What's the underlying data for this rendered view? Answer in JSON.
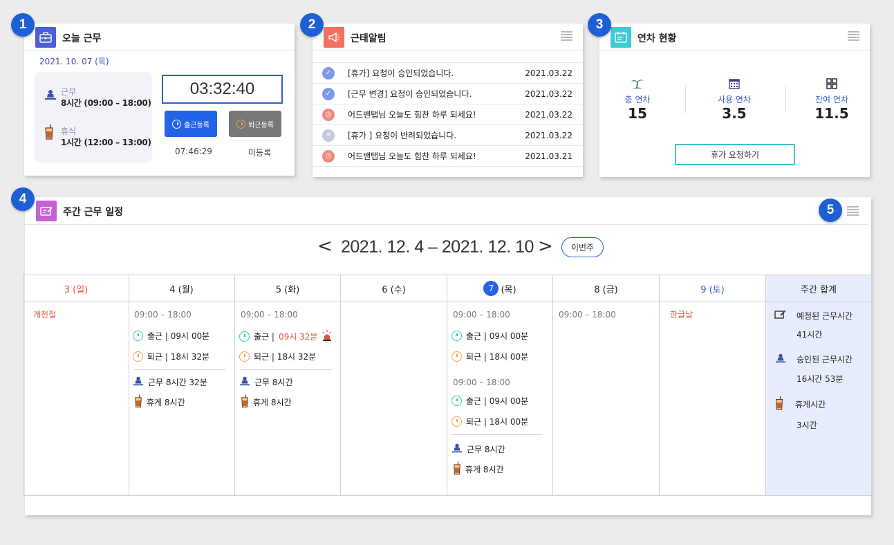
{
  "badges": [
    "1",
    "2",
    "3",
    "4",
    "5"
  ],
  "today_work": {
    "title": "오늘 근무",
    "date": "2021. 10. 07 (목)",
    "work_label": "근무",
    "work_value": "8시간  (09:00 – 18:00)",
    "rest_label": "휴식",
    "rest_value": "1시간  (12:00 – 13:00)",
    "clock": "03:32:40",
    "checkin_button": "출근등록",
    "checkout_button": "퇴근등록",
    "checkin_time": "07:46:29",
    "checkout_status": "미등록"
  },
  "alerts": {
    "title": "근태알림",
    "items": [
      {
        "text": "[휴가] 요청이 승인되었습니다.",
        "date": "2021.03.22",
        "icon": "check-icon",
        "color": "#7d98e8"
      },
      {
        "text": "[근무 변경] 요청이 승인되었습니다.",
        "date": "2021.03.22",
        "icon": "check-icon",
        "color": "#7d98e8"
      },
      {
        "text": "어드밴탭님 오늘도 힘찬 하루 되세요!",
        "date": "2021.03.22",
        "icon": "clock-icon",
        "color": "#f08a80"
      },
      {
        "text": "[휴가 ] 요청이 반려되었습니다.",
        "date": "2021.03.22",
        "icon": "x-icon",
        "color": "#c5c9d6"
      },
      {
        "text": "어드밴탭님 오늘도 힘찬 하루 되세요!",
        "date": "2021.03.21",
        "icon": "clock-icon",
        "color": "#f08a80"
      }
    ]
  },
  "leave": {
    "title": "연차 현황",
    "total_label": "총 연차",
    "total_value": "15",
    "used_label": "사용 연차",
    "used_value": "3.5",
    "remaining_label": "잔여 연차",
    "remaining_value": "11.5",
    "request_button": "휴가 요청하기"
  },
  "weekly": {
    "title": "주간 근무 일정",
    "prev": "<",
    "next": ">",
    "range": "2021. 12. 4 – 2021. 12. 10",
    "this_week_button": "이번주",
    "days": [
      {
        "label": "3 (일)",
        "color": "#e0563a"
      },
      {
        "label": "4 (월)",
        "color": "#222"
      },
      {
        "label": "5 (화)",
        "color": "#222"
      },
      {
        "label": "6 (수)",
        "color": "#222"
      },
      {
        "num": "7",
        "suffix": "(목)",
        "color": "#222"
      },
      {
        "label": "8 (금)",
        "color": "#222"
      },
      {
        "label": "9 (토)",
        "color": "#2f5fc7"
      },
      {
        "label": "주간 합계",
        "color": "#222"
      }
    ],
    "holidays": {
      "sun": "개천절",
      "sat": "한글날"
    },
    "mon": {
      "sched": "09:00 – 18:00",
      "in": "출근 |  09시 00분",
      "out": "퇴근 |  18시 32분",
      "work": "근무 8시간 32분",
      "rest": "휴게 8시간"
    },
    "tue": {
      "sched": "09:00 – 18:00",
      "in_prefix": "출근 |",
      "in_late": "09시 32분",
      "out": "퇴근 |  18시 32분",
      "work": "근무 8시간",
      "rest": "휴게 8시간"
    },
    "thu": {
      "sched1": "09:00 – 18:00",
      "in1": "출근 |  09시 00분",
      "out1": "퇴근 |  18시 00분",
      "sched2": "09:00 – 18:00",
      "in2": "출근 |  09시 00분",
      "out2": "퇴근 |  18시 00분",
      "work": "근무 8시간",
      "rest": "휴게 8시간"
    },
    "fri": {
      "sched": "09:00 – 18:00"
    },
    "summary": {
      "planned_label": "예정된 근무시간",
      "planned_value": "41시간",
      "approved_label": "승인된 근무시간",
      "approved_value": "16시간 53분",
      "rest_label": "휴게시간",
      "rest_value": "3시간"
    }
  },
  "colors": {
    "accent": "#2563e6",
    "teal": "#3fc0c9",
    "holiday": "#e0563a",
    "summary_bg": "#e7edfc"
  }
}
